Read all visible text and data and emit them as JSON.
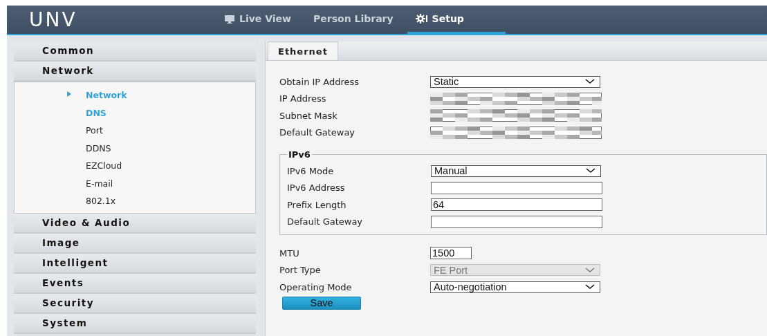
{
  "header": {
    "logo": "UNV",
    "nav": [
      {
        "label": "Live View",
        "selected": false
      },
      {
        "label": "Person Library",
        "selected": false
      },
      {
        "label": "Setup",
        "selected": true
      }
    ]
  },
  "sidebar": {
    "sections": [
      {
        "label": "Common"
      },
      {
        "label": "Network",
        "items": [
          {
            "label": "Network",
            "selected": true,
            "highlighted": true
          },
          {
            "label": "DNS",
            "selected": false,
            "highlighted": true
          },
          {
            "label": "Port",
            "selected": false,
            "highlighted": false
          },
          {
            "label": "DDNS",
            "selected": false,
            "highlighted": false
          },
          {
            "label": "EZCloud",
            "selected": false,
            "highlighted": false
          },
          {
            "label": "E-mail",
            "selected": false,
            "highlighted": false
          },
          {
            "label": "802.1x",
            "selected": false,
            "highlighted": false
          }
        ]
      },
      {
        "label": "Video & Audio"
      },
      {
        "label": "Image"
      },
      {
        "label": "Intelligent"
      },
      {
        "label": "Events"
      },
      {
        "label": "Security"
      },
      {
        "label": "System"
      }
    ]
  },
  "tabs": [
    {
      "label": "Ethernet",
      "selected": true
    }
  ],
  "ipv4": [
    {
      "label": "Obtain IP Address",
      "kind": "select",
      "value": "Static",
      "disabled": false
    },
    {
      "label": "IP Address",
      "kind": "text",
      "redacted": true
    },
    {
      "label": "Subnet Mask",
      "kind": "text",
      "redacted": true
    },
    {
      "label": "Default Gateway",
      "kind": "text",
      "redacted": true
    }
  ],
  "ipv6": {
    "legend": "IPv6",
    "fields": [
      {
        "label": "IPv6 Mode",
        "kind": "select",
        "value": "Manual",
        "disabled": false
      },
      {
        "label": "IPv6 Address",
        "kind": "text",
        "redacted": false
      },
      {
        "label": "Prefix Length",
        "kind": "text",
        "value": "64",
        "redacted": false
      },
      {
        "label": "Default Gateway",
        "kind": "text",
        "redacted": false
      }
    ]
  },
  "other": [
    {
      "label": "MTU",
      "kind": "short",
      "value": "1500"
    },
    {
      "label": "Port Type",
      "kind": "select",
      "value": "FE Port",
      "disabled": true
    },
    {
      "label": "Operating Mode",
      "kind": "select",
      "value": "Auto-negotiation",
      "disabled": false
    }
  ],
  "save_button": "Save"
}
